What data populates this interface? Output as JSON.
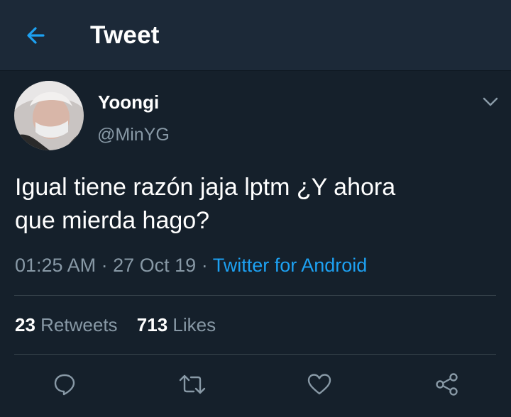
{
  "header": {
    "title": "Tweet",
    "back_icon": "arrow-left-icon"
  },
  "tweet": {
    "display_name": "Yoongi",
    "handle": "@MinYG",
    "text_line1": "Igual tiene razón jaja lptm ¿Y ahora",
    "text_line2": "que mierda hago?",
    "time": "01:25 AM",
    "date": "27 Oct 19",
    "separator": "·",
    "source": "Twitter for Android",
    "retweets_count": "23",
    "retweets_label": "Retweets",
    "likes_count": "713",
    "likes_label": "Likes"
  },
  "actions": [
    "reply-icon",
    "retweet-icon",
    "like-icon",
    "share-icon"
  ],
  "colors": {
    "background": "#15202b",
    "header": "#1c2938",
    "accent": "#1da1f2",
    "muted": "#8899a6",
    "divider": "#38444d"
  }
}
